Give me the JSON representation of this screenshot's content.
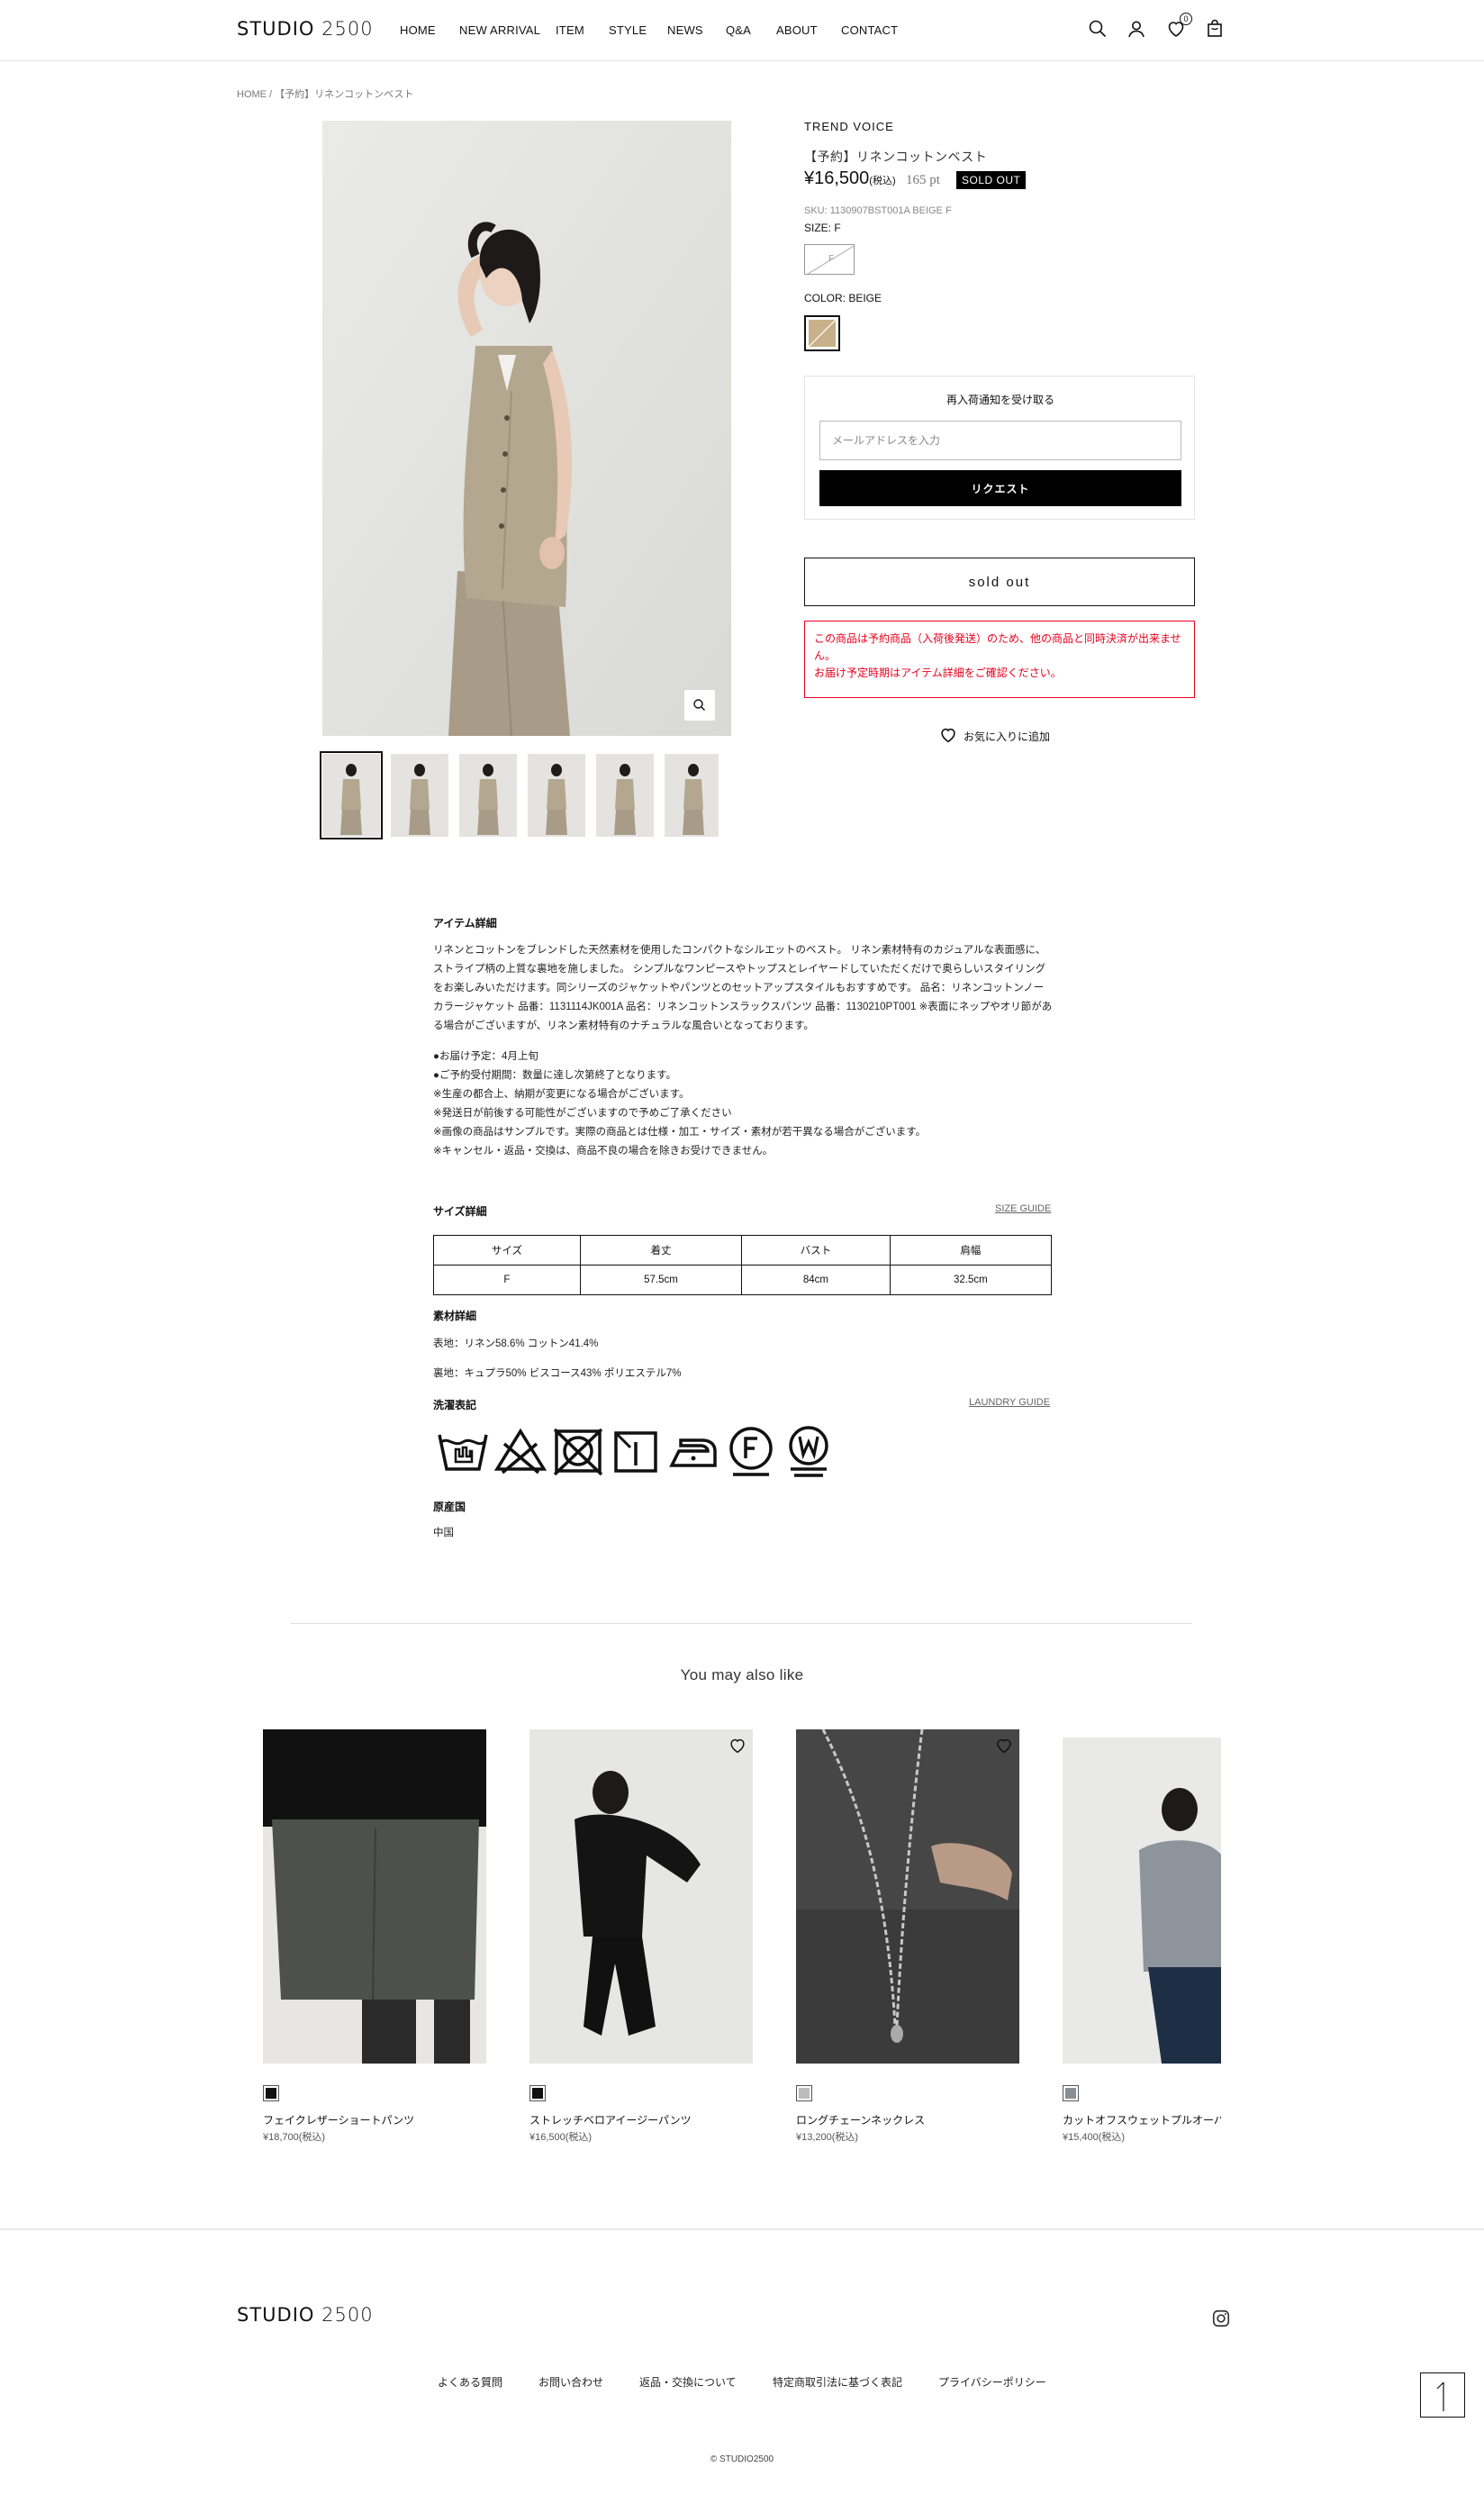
{
  "header": {
    "logo_main": "STUDIO",
    "logo_num": "2500",
    "nav": [
      "HOME",
      "NEW ARRIVAL",
      "ITEM",
      "STYLE",
      "NEWS",
      "Q&A",
      "ABOUT",
      "CONTACT"
    ],
    "wishlist_count": "0"
  },
  "breadcrumb": "HOME /  【予約】リネンコットンベスト",
  "product": {
    "brand": "TREND VOICE",
    "name": "【予約】リネンコットンベスト",
    "price": "¥16,500",
    "tax_note": "(税込)",
    "points": "165 pt",
    "status_badge": "SOLD OUT",
    "sku": "SKU: 1130907BST001A BEIGE F",
    "size_label": "SIZE:  F",
    "size_option": "F",
    "color_label": "COLOR:  BEIGE",
    "color_hex": "#c8b08a",
    "thumb_count": 6
  },
  "notify": {
    "title": "再入荷通知を受け取る",
    "placeholder": "メールアドレスを入力",
    "button": "リクエスト"
  },
  "soldout_button": "sold out",
  "notice": [
    "この商品は予約商品（入荷後発送）のため、他の商品と同時決済が出来ません。",
    "お届け予定時期はアイテム詳細をご確認ください。"
  ],
  "favorite_label": "お気に入りに追加",
  "details": {
    "item_heading": "アイテム詳細",
    "item_text": "リネンとコットンをブレンドした天然素材を使用したコンパクトなシルエットのベスト。 リネン素材特有のカジュアルな表面感に、ストライプ柄の上質な裏地を施しました。 シンプルなワンピースやトップスとレイヤードしていただくだけで奥らしいスタイリングをお楽しみいただけます。同シリーズのジャケットやパンツとのセットアップスタイルもおすすめです。 品名：リネンコットンノーカラージャケット 品番：1131114JK001A 品名：リネンコットンスラックスパンツ 品番：1130210PT001 ※表面にネップやオリ節がある場合がございますが、リネン素材特有のナチュラルな風合いとなっております。",
    "delivery_notes": [
      "●お届け予定：4月上旬",
      "●ご予約受付期間：数量に達し次第終了となります。",
      "※生産の都合上、納期が変更になる場合がございます。",
      "※発送日が前後する可能性がございますので予めご了承ください",
      "※画像の商品はサンプルです。実際の商品とは仕様・加工・サイズ・素材が若干異なる場合がございます。",
      "※キャンセル・返品・交換は、商品不良の場合を除きお受けできません。"
    ],
    "size_heading": "サイズ詳細",
    "size_guide": "SIZE GUIDE",
    "size_table": {
      "headers": [
        "サイズ",
        "着丈",
        "バスト",
        "肩幅"
      ],
      "row": [
        "F",
        "57.5cm",
        "84cm",
        "32.5cm"
      ]
    },
    "material_heading": "素材詳細",
    "material_outer": "表地：リネン58.6% コットン41.4%",
    "material_lining": "裏地：キュプラ50% ビスコース43% ポリエステル7%",
    "care_heading": "洗濯表記",
    "laundry_guide": "LAUNDRY GUIDE",
    "origin_heading": "原産国",
    "origin": "中国"
  },
  "recommend": {
    "title": "You may also like",
    "items": [
      {
        "name": "フェイクレザーショートパンツ",
        "price": "¥18,700(税込)",
        "swatch": "#111111"
      },
      {
        "name": "ストレッチベロアイージーパンツ",
        "price": "¥16,500(税込)",
        "swatch": "#111111"
      },
      {
        "name": "ロングチェーンネックレス",
        "price": "¥13,200(税込)",
        "swatch": "#bdbdbd"
      },
      {
        "name": "カットオフスウェットプルオーバー",
        "price": "¥15,400(税込)",
        "swatch": "#8a8f96"
      }
    ]
  },
  "footer": {
    "logo_main": "STUDIO",
    "logo_num": "2500",
    "links": [
      "よくある質問",
      "お問い合わせ",
      "返品・交換について",
      "特定商取引法に基づく表記",
      "プライバシーポリシー"
    ],
    "copyright": "© STUDIO2500"
  }
}
